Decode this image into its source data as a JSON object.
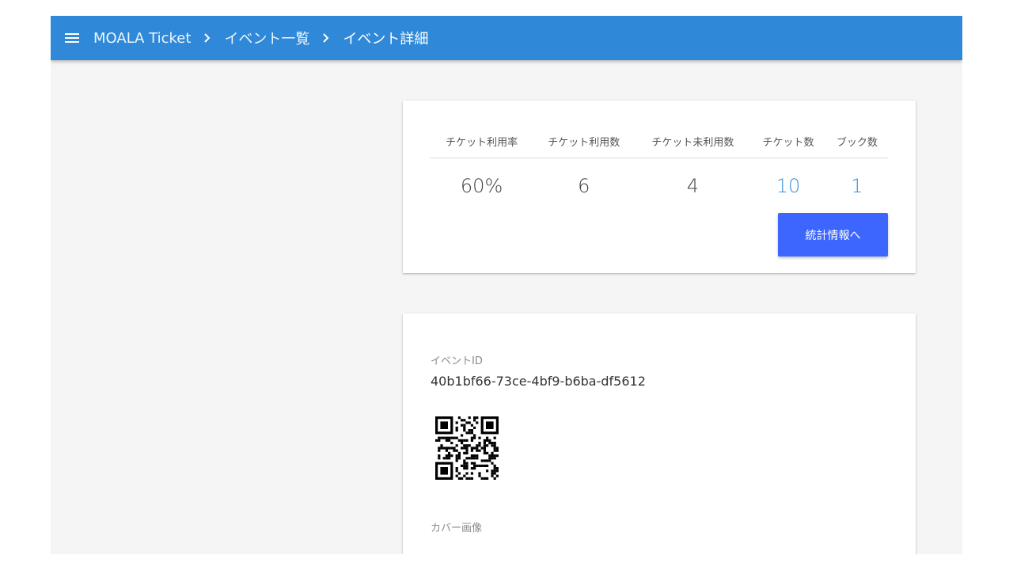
{
  "header": {
    "app_name": "MOALA Ticket",
    "breadcrumb": [
      "イベント一覧",
      "イベント詳細"
    ]
  },
  "stats": {
    "headers": [
      "チケット利用率",
      "チケット利用数",
      "チケット未利用数",
      "チケット数",
      "ブック数"
    ],
    "values": [
      "60%",
      "6",
      "4",
      "10",
      "1"
    ],
    "button_label": "統計情報へ"
  },
  "event": {
    "id_label": "イベントID",
    "id_value": "40b1bf66-73ce-4bf9-b6ba-df5612",
    "cover_label": "カバー画像"
  },
  "colors": {
    "topbar": "#2f88d8",
    "link": "#3a90df",
    "button": "#3d66ff"
  }
}
